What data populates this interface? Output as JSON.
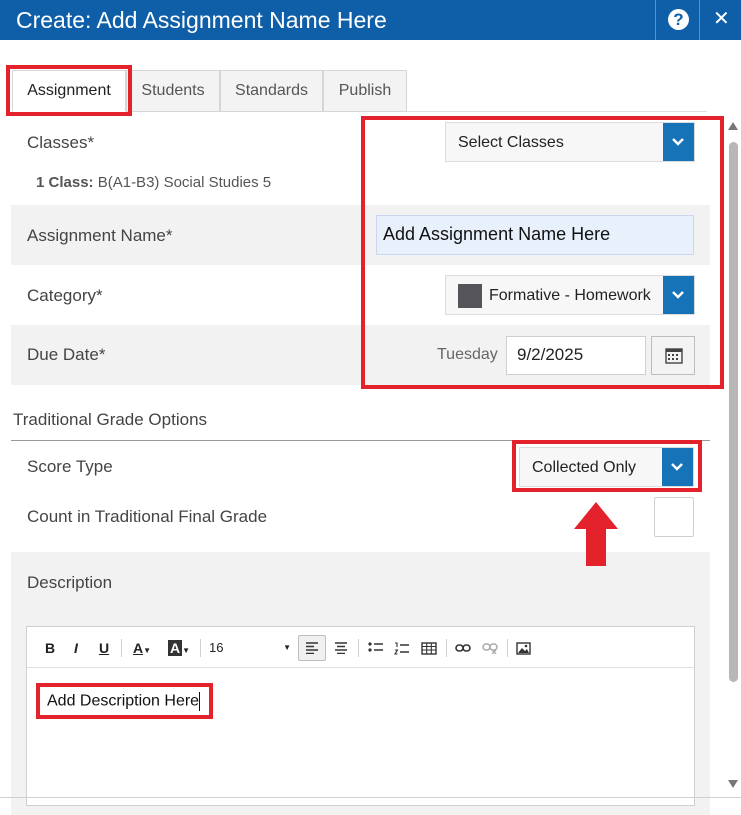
{
  "window": {
    "title": "Create: Add Assignment Name Here",
    "help_label": "?",
    "close_label": "✕",
    "accent_color": "#0e5fa8"
  },
  "tabs": [
    {
      "label": "Assignment",
      "active": true
    },
    {
      "label": "Students",
      "active": false
    },
    {
      "label": "Standards",
      "active": false
    },
    {
      "label": "Publish",
      "active": false
    }
  ],
  "form": {
    "classes": {
      "label": "Classes*",
      "select_value": "Select Classes",
      "summary_prefix": "1 Class:",
      "summary_value": "B(A1-B3) Social Studies 5"
    },
    "assignment_name": {
      "label": "Assignment Name*",
      "value": "Add Assignment Name Here"
    },
    "category": {
      "label": "Category*",
      "value": "Formative - Homework",
      "swatch_color": "#555559"
    },
    "due_date": {
      "label": "Due Date*",
      "weekday": "Tuesday",
      "value": "9/2/2025",
      "icon": "calendar-icon"
    }
  },
  "grade_options": {
    "section_title": "Traditional Grade Options",
    "score_type": {
      "label": "Score Type",
      "value": "Collected Only"
    },
    "count_in_final": {
      "label": "Count in Traditional Final Grade",
      "checked": false
    }
  },
  "description": {
    "label": "Description",
    "toolbar": {
      "bold": "B",
      "italic": "I",
      "underline": "U",
      "font_color": "A",
      "highlight": "A",
      "font_size": "16"
    },
    "content": "Add Description Here"
  },
  "annotation_color": "#e3222b"
}
